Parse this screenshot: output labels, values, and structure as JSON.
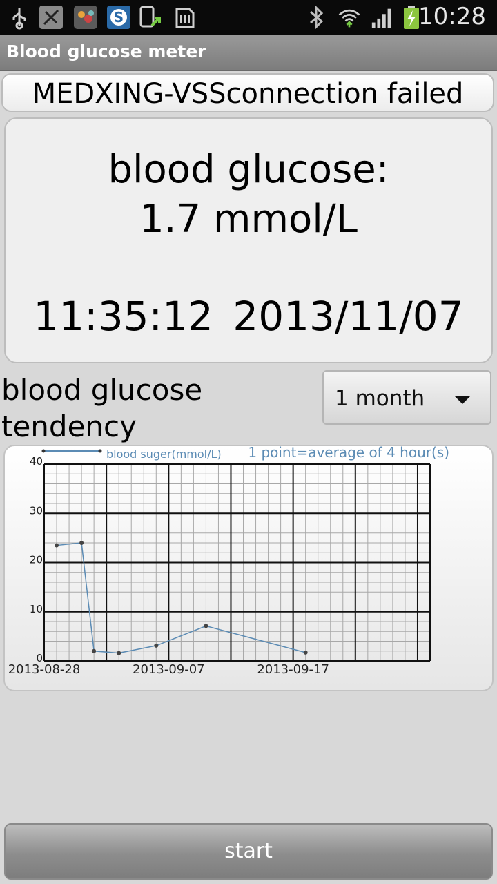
{
  "status_bar": {
    "time": "10:28",
    "icons": [
      "usb-icon",
      "app-icon",
      "weather-app-icon",
      "s-app-icon",
      "update-icon",
      "sd-card-icon",
      "bluetooth-icon",
      "wifi-icon",
      "signal-icon",
      "battery-charging-icon"
    ]
  },
  "app": {
    "title": "Blood glucose meter"
  },
  "connection": {
    "text": "MEDXING-VSSconnection failed"
  },
  "reading": {
    "label": "blood glucose:",
    "value": "1.7 mmol/L",
    "timestamp": "11:35:12  2013/11/07"
  },
  "tendency": {
    "label_line1": "blood glucose",
    "label_line2": "tendency",
    "period_selected": "1 month"
  },
  "chart_data": {
    "type": "line",
    "series": [
      {
        "name": "blood suger(mmol/L)",
        "x": [
          "2013-08-29",
          "2013-08-31",
          "2013-09-01",
          "2013-09-03",
          "2013-09-06",
          "2013-09-10",
          "2013-09-18"
        ],
        "values": [
          23.5,
          24,
          2,
          1.6,
          3.1,
          7.1,
          1.7
        ]
      }
    ],
    "legend_label": "blood suger(mmol/L)",
    "annotation": "1 point=average of 4 hour(s)",
    "x_ticks": [
      "2013-08-28",
      "2013-09-07",
      "2013-09-17"
    ],
    "y_ticks": [
      "0",
      "10",
      "20",
      "30",
      "40"
    ],
    "xlim": [
      "2013-08-28",
      "2013-09-28"
    ],
    "ylim": [
      0,
      40
    ],
    "grid": true,
    "line_color": "#5b8bb4"
  },
  "actions": {
    "start_label": "start"
  }
}
